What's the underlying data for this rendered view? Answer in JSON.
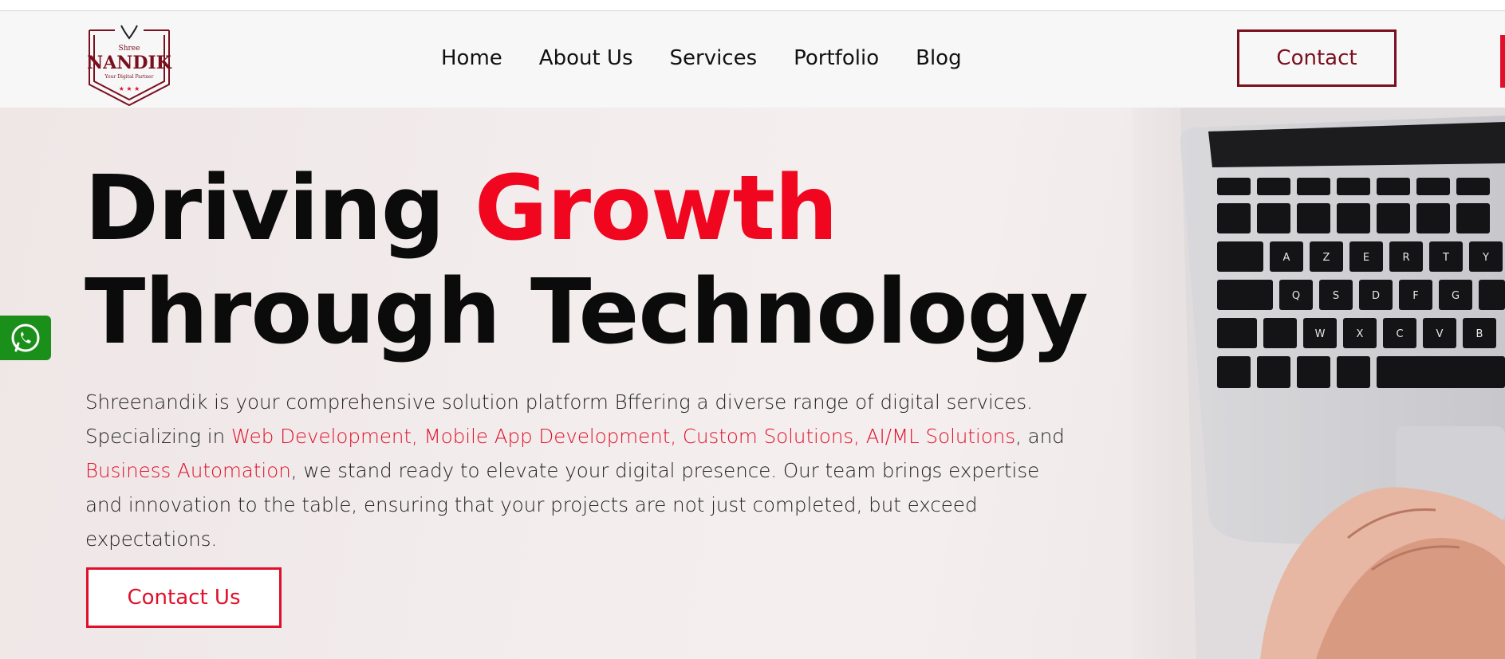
{
  "brand": {
    "logo_small": "Shree",
    "logo_name": "NANDIK",
    "logo_tagline": "Your Digital Partner"
  },
  "nav": {
    "items": [
      {
        "label": "Home"
      },
      {
        "label": "About Us"
      },
      {
        "label": "Services"
      },
      {
        "label": "Portfolio"
      },
      {
        "label": "Blog"
      }
    ],
    "contact_label": "Contact"
  },
  "hero": {
    "title_part1": "Driving",
    "title_accent": "Growth",
    "title_line2": "Through Technology",
    "desc_part1": "Shreenandik is your comprehensive solution platform Bffering a diverse range of digital services. Specializing in ",
    "desc_highlight1": "Web Development, Mobile App Development, Custom Solutions, AI/ML Solutions",
    "desc_part2": ", and ",
    "desc_highlight2": "Business Automation",
    "desc_part3": ", we stand ready to elevate your digital presence. Our team brings expertise and innovation to the table, ensuring that your projects are not just completed, but exceed expectations.",
    "cta_label": "Contact Us"
  },
  "colors": {
    "accent_red": "#f0061f",
    "brand_maroon": "#7a0f1e",
    "whatsapp_green": "#1a8f1a"
  },
  "icons": {
    "floating": "whatsapp-icon"
  }
}
